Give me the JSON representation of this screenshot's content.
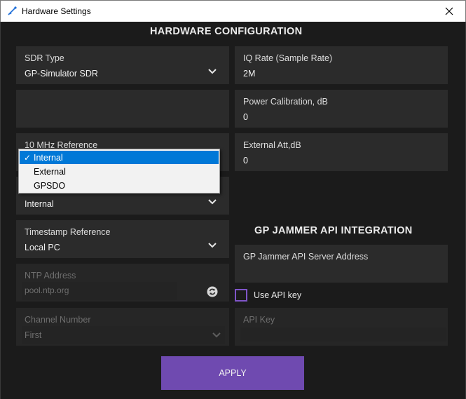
{
  "window": {
    "title": "Hardware Settings"
  },
  "hardware": {
    "heading": "HARDWARE CONFIGURATION",
    "sdr_type": {
      "label": "SDR Type",
      "value": "GP-Simulator SDR"
    },
    "ref10mhz": {
      "label": "10 MHz Reference",
      "options": [
        {
          "label": "Internal",
          "selected": true
        },
        {
          "label": "External",
          "selected": false
        },
        {
          "label": "GPSDO",
          "selected": false
        }
      ]
    },
    "hidden_select": {
      "value": "Internal"
    },
    "timestamp_ref": {
      "label": "Timestamp Reference",
      "value": "Local PC"
    },
    "ntp": {
      "label": "NTP Address",
      "value": "pool.ntp.org"
    },
    "channel": {
      "label": "Channel Number",
      "value": "First"
    },
    "iq_rate": {
      "label": "IQ Rate (Sample Rate)",
      "value": "2M"
    },
    "power_cal": {
      "label": "Power Calibration, dB",
      "value": "0"
    },
    "ext_att": {
      "label": "External Att,dB",
      "value": "0"
    }
  },
  "api": {
    "heading": "GP JAMMER API INTEGRATION",
    "server_address": {
      "label": "GP Jammer API Server Address",
      "value": ""
    },
    "use_api_key": {
      "label": "Use API key",
      "checked": false
    },
    "api_key": {
      "label": "API Key",
      "value": ""
    }
  },
  "apply_label": "APPLY",
  "colors": {
    "accent": "#6f4ab0",
    "checkbox_border": "#7f55c8",
    "selection": "#0078d7",
    "panel": "#2b2b2b",
    "background": "#1b1b1b"
  }
}
